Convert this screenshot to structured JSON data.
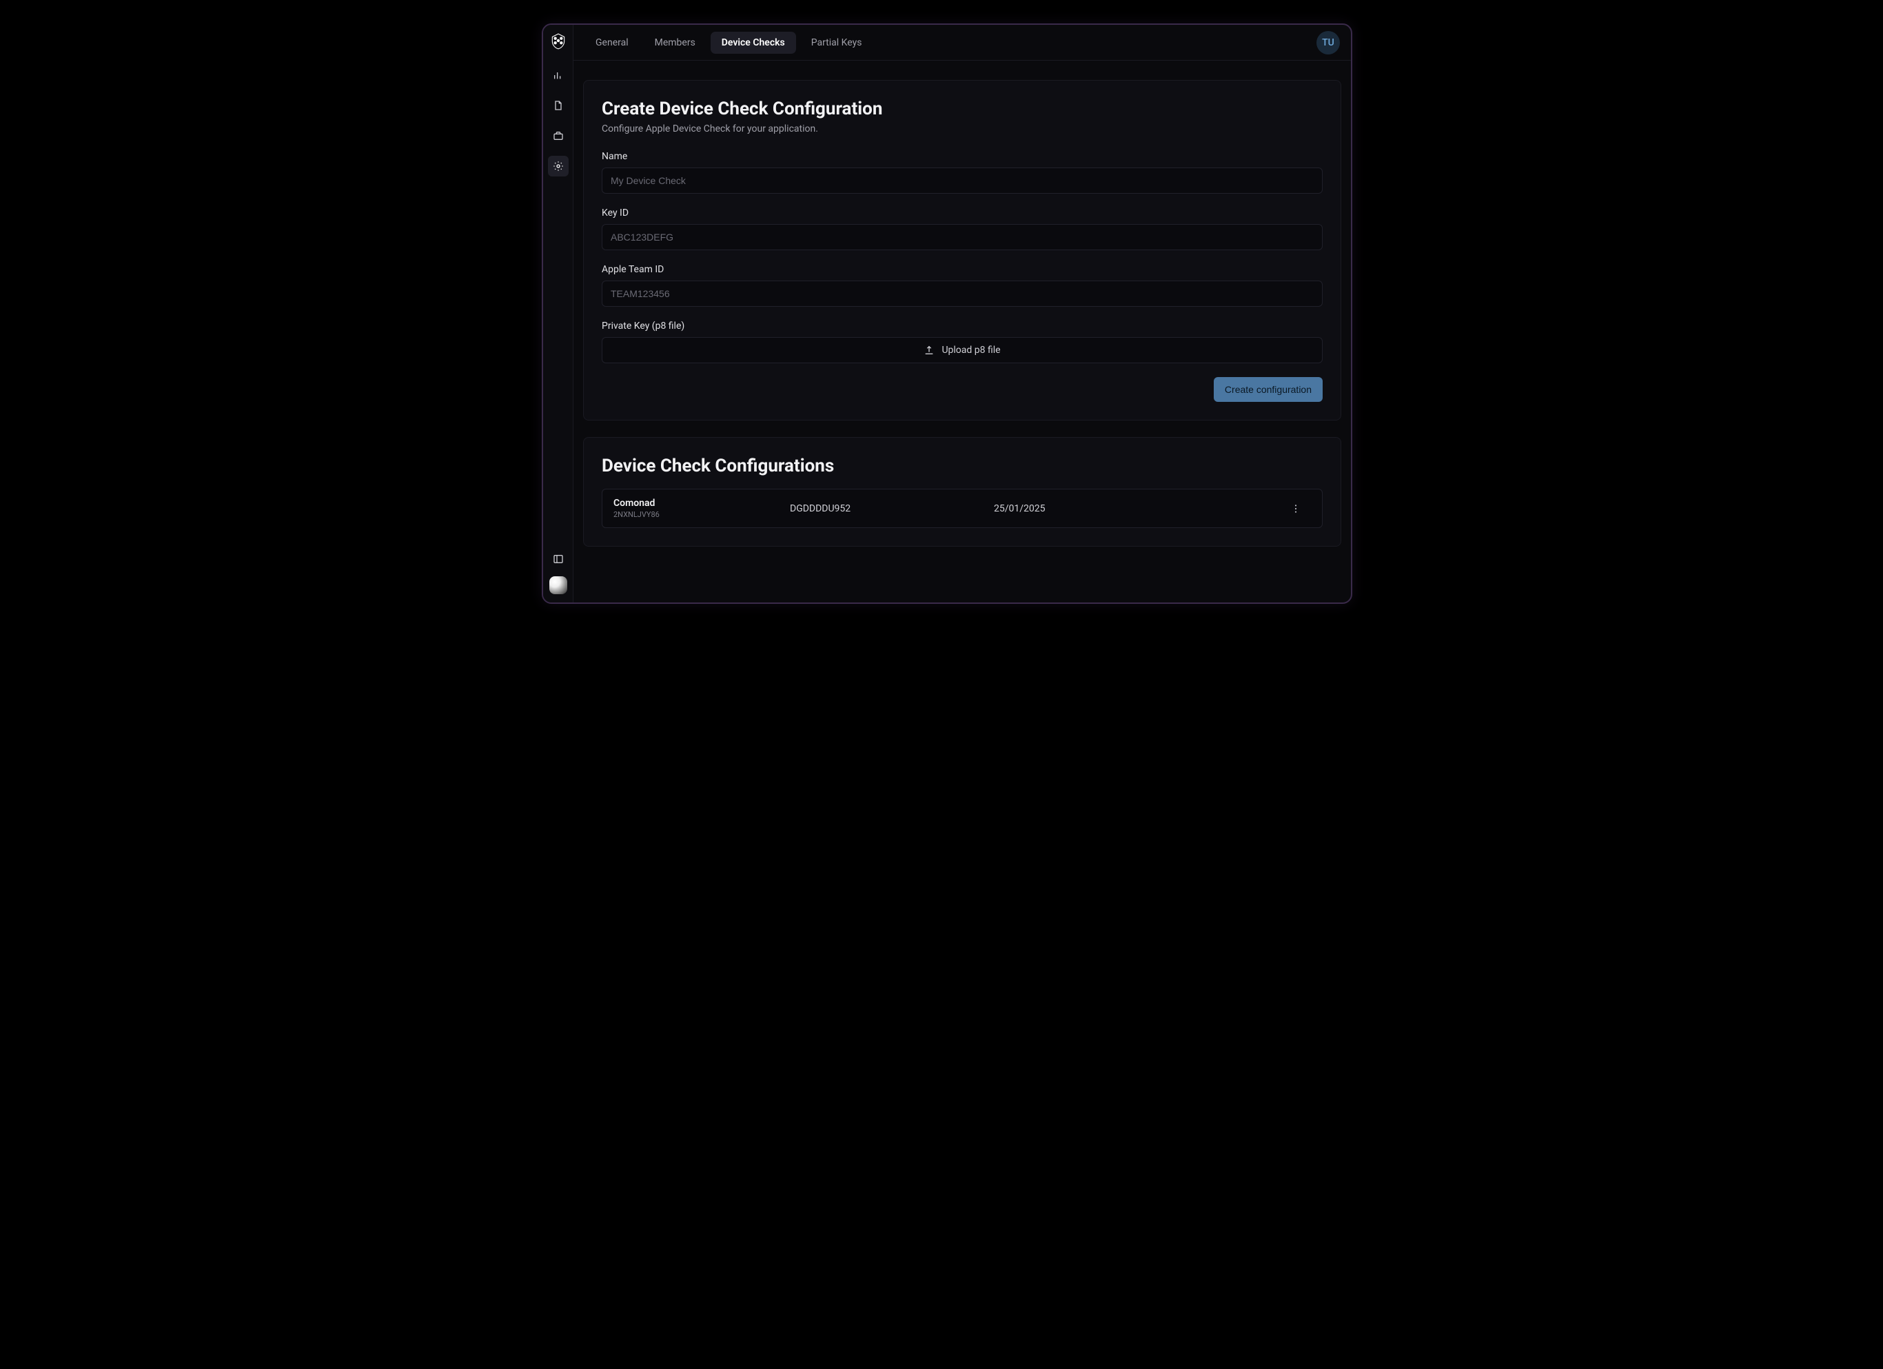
{
  "user_initials": "TU",
  "tabs": [
    {
      "label": "General"
    },
    {
      "label": "Members"
    },
    {
      "label": "Device Checks"
    },
    {
      "label": "Partial Keys"
    }
  ],
  "active_tab_index": 2,
  "form": {
    "title": "Create Device Check Configuration",
    "subtitle": "Configure Apple Device Check for your application.",
    "name_label": "Name",
    "name_placeholder": "My Device Check",
    "keyid_label": "Key ID",
    "keyid_placeholder": "ABC123DEFG",
    "teamid_label": "Apple Team ID",
    "teamid_placeholder": "TEAM123456",
    "pkey_label": "Private Key (p8 file)",
    "upload_text": "Upload p8 file",
    "submit_label": "Create configuration"
  },
  "list": {
    "title": "Device Check Configurations",
    "rows": [
      {
        "name": "Comonad",
        "sub": "2NXNLJVY86",
        "keyid": "DGDDDDU952",
        "date": "25/01/2025"
      }
    ]
  }
}
